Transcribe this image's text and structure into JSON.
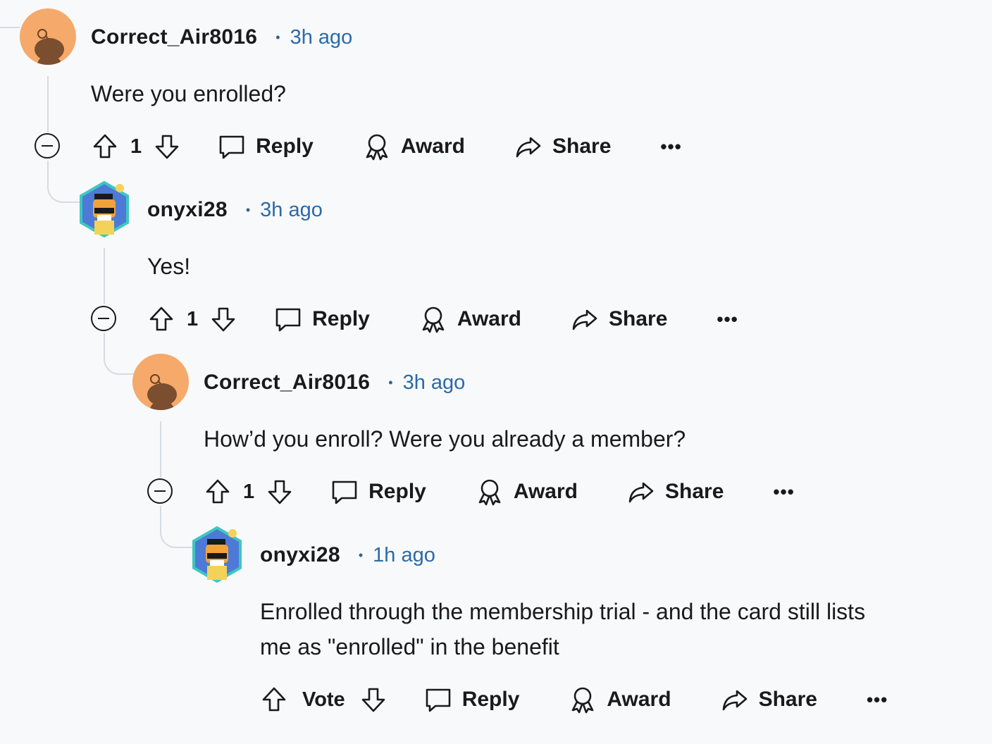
{
  "comments": [
    {
      "username": "Correct_Air8016",
      "dot": "•",
      "time": "3h ago",
      "body": "Were you enrolled?",
      "votes": "1",
      "avatar": "snoo-avatar-orange"
    },
    {
      "username": "onyxi28",
      "dot": "•",
      "time": "3h ago",
      "body": "Yes!",
      "votes": "1",
      "avatar": "cat-avatar-hexagon"
    },
    {
      "username": "Correct_Air8016",
      "dot": "•",
      "time": "3h ago",
      "body": "How’d you enroll? Were you already a member?",
      "votes": "1",
      "avatar": "snoo-avatar-orange"
    },
    {
      "username": "onyxi28",
      "dot": "•",
      "time": "1h ago",
      "body_line1": "Enrolled through the membership trial - and the card still lists",
      "body_line2": "me as \"enrolled\" in the benefit",
      "votes": "Vote",
      "avatar": "cat-avatar-hexagon"
    }
  ],
  "actions": {
    "reply": "Reply",
    "award": "Award",
    "share": "Share",
    "more": "•••"
  },
  "icons": [
    "upvote-icon",
    "downvote-icon",
    "reply-icon",
    "award-icon",
    "share-icon",
    "collapse-icon"
  ],
  "colors": {
    "background": "#f8f9fb",
    "timestamp": "#2b6aa6",
    "thread_line": "#d5dbe2",
    "snoo_avatar_bg": "#f5a96a"
  }
}
